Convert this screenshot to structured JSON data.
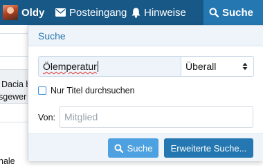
{
  "navbar": {
    "user_label": "Oldy",
    "inbox_label": "Posteingang",
    "alerts_label": "Hinweise",
    "search_label": "Suche",
    "colors": {
      "bar": "#185886",
      "active": "#2577b1"
    }
  },
  "background": {
    "snippet_1": "Dacia b",
    "snippet_2": "sgewer",
    "snippet_3": "nale"
  },
  "search_panel": {
    "title": "Suche",
    "query_value": "Ölemperatur",
    "scope_value": "Überall",
    "titles_only_label": "Nur Titel durchsuchen",
    "titles_only_checked": false,
    "member_label": "Von:",
    "member_placeholder": "Mitglied",
    "search_button": "Suche",
    "advanced_button": "Erweiterte Suche..."
  },
  "icons": {
    "inbox": "envelope-icon",
    "alerts": "bell-icon",
    "search": "search-icon",
    "scope": "updown-arrows-icon"
  }
}
